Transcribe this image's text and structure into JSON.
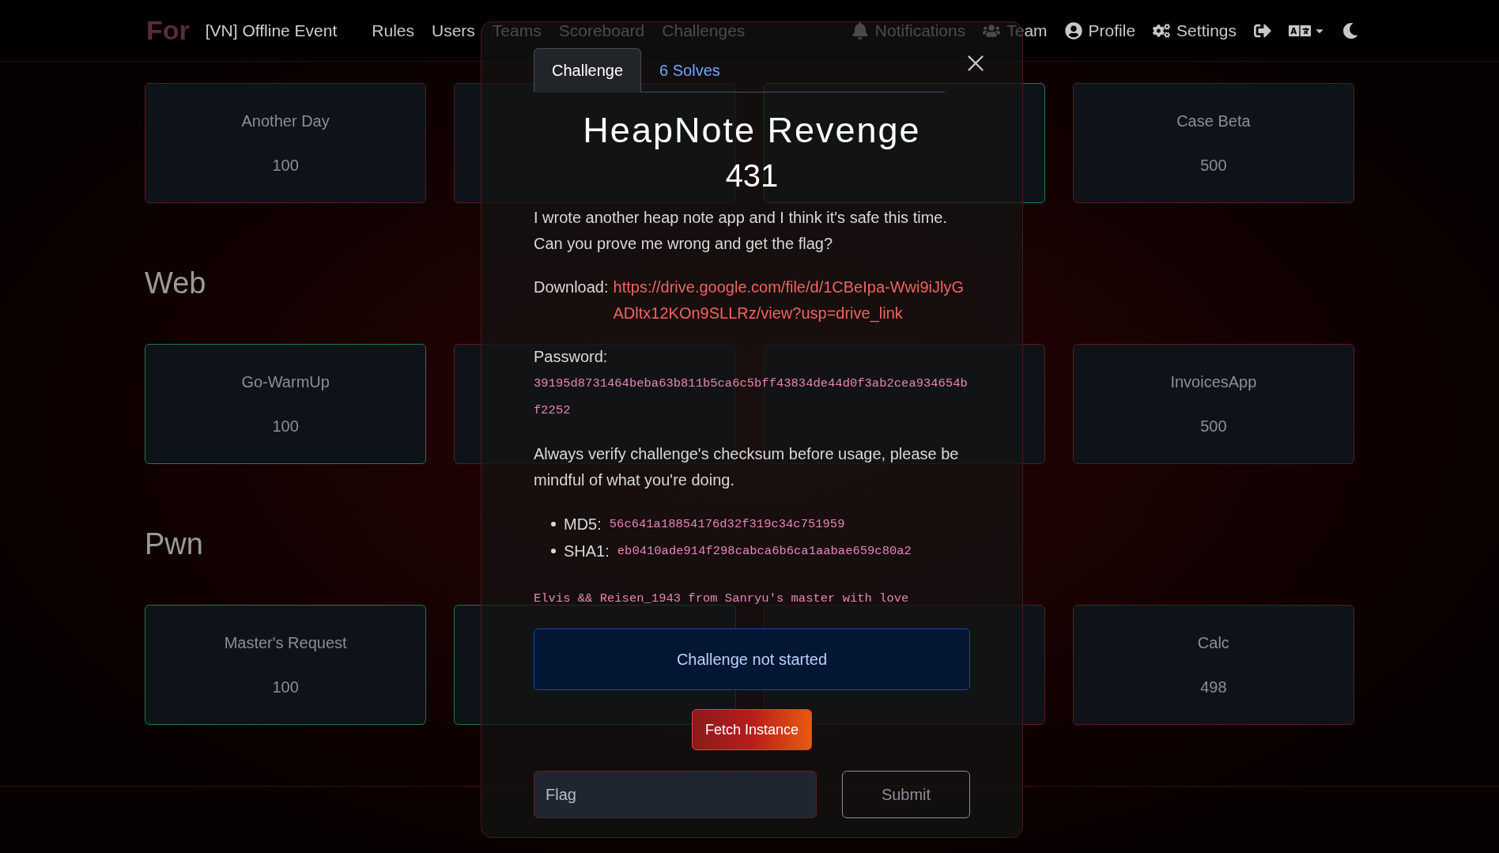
{
  "navbar": {
    "logo": "For",
    "brand": "[VN] Offline Event",
    "links": [
      "Rules",
      "Users",
      "Teams",
      "Scoreboard",
      "Challenges"
    ],
    "right_links": [
      {
        "kind": "bell",
        "label": "Notifications"
      },
      {
        "kind": "users",
        "label": "Team"
      },
      {
        "kind": "user",
        "label": "Profile"
      },
      {
        "kind": "gears",
        "label": "Settings"
      }
    ]
  },
  "sections": [
    {
      "cards": [
        {
          "name": "Another Day",
          "points": "100",
          "solved": false
        },
        {
          "solved": false
        },
        {
          "solved": true
        },
        {
          "name": "Case Beta",
          "points": "500",
          "solved": false
        }
      ]
    },
    {
      "heading": "Web",
      "cards": [
        {
          "name": "Go-WarmUp",
          "points": "100",
          "solved": true
        },
        {
          "solved": false
        },
        {
          "solved": false
        },
        {
          "name": "InvoicesApp",
          "points": "500",
          "solved": false
        }
      ]
    },
    {
      "heading": "Pwn",
      "cards": [
        {
          "name": "Master's Request",
          "points": "100",
          "solved": true
        },
        {
          "solved": true
        },
        {
          "solved": false
        },
        {
          "name": "Calc",
          "points": "498",
          "solved": false
        }
      ]
    }
  ],
  "modal": {
    "tabs": [
      {
        "label": "Challenge",
        "selected": true
      },
      {
        "label": "6 Solves",
        "selected": false
      }
    ],
    "title": "HeapNote Revenge",
    "points": "431",
    "description": [
      {
        "kind": "text",
        "text": "I wrote another heap note app and I think it's safe this time. Can you prove me wrong and get the flag?"
      },
      {
        "kind": "link",
        "label": "Download:",
        "url": "https://drive.google.com/file/d/1CBeIpa-Wwi9iJlyGADltx12KOn9SLLRz/view?usp=drive_link"
      },
      {
        "kind": "code",
        "label": "Password:",
        "code": "39195d8731464beba63b811b5ca6c5bff43834de44d0f3ab2cea934654bf2252"
      },
      {
        "kind": "text",
        "text": "Always verify challenge's checksum before usage, please be mindful of what you're doing."
      },
      {
        "kind": "list",
        "items": [
          {
            "label": "MD5:",
            "code": "56c641a18854176d32f319c34c751959"
          },
          {
            "label": "SHA1:",
            "code": "eb0410ade914f298cabca6b6ca1aabae659c80a2"
          }
        ]
      },
      {
        "kind": "signature",
        "code": "Elvis && Reisen_1943 from Sanryu's master with love"
      }
    ],
    "status": "Challenge not started",
    "fetch_button": "Fetch Instance",
    "flag_field": {
      "placeholder": "Flag"
    },
    "submit_button": "Submit"
  }
}
